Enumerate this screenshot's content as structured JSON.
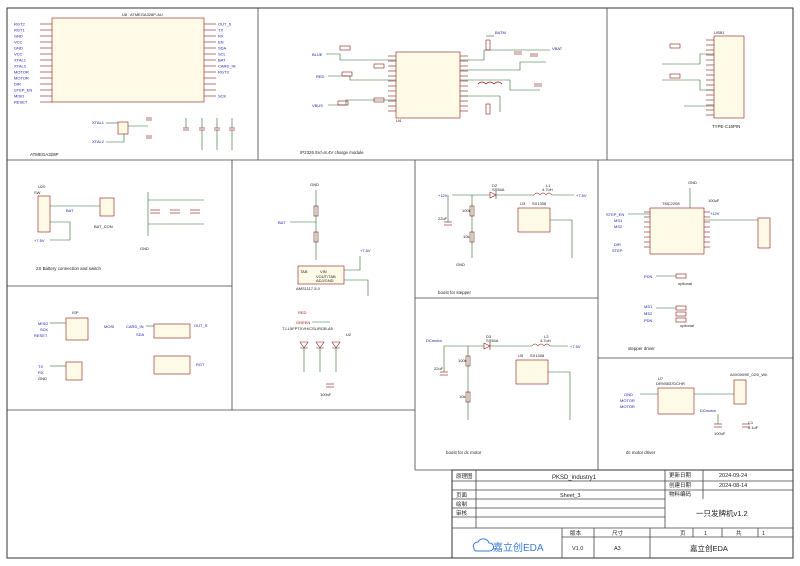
{
  "sections": {
    "mcu": {
      "caption": "ATMEGA328P",
      "part": "ATMEGA328P-AU",
      "ref": "U8",
      "left_nets": [
        "RGT2",
        "RGT1",
        "GND",
        "VCC",
        "GND",
        "VCC",
        "XTAL1",
        "XTAL2",
        "MOTOR",
        "MOTOR",
        "DIR",
        "STEP_EN",
        "MISO",
        "RESET"
      ],
      "right_nets": [
        "OUT_S",
        "TX",
        "RX",
        "EN",
        "SDA",
        "SCL",
        "BAT",
        "CARD_IN",
        "RGT3",
        "",
        "",
        "",
        "SCK"
      ],
      "xtal": [
        "XTAL1",
        "XTAL2"
      ]
    },
    "charge": {
      "caption": "IP2326 5V/=8.4V charge module",
      "ref": "U4",
      "nets": [
        "BLUE",
        "RED",
        "VBUS",
        "BATM",
        "VBAT"
      ]
    },
    "usb": {
      "caption": "TYPE-C16PIN",
      "ref": "USB1"
    },
    "battery": {
      "caption": "2S Battery connection and switch",
      "labels": [
        "U20",
        "SW",
        "BAT",
        "BAT_CON",
        "+7.5V",
        "GND"
      ]
    },
    "ldo": {
      "labels": [
        "GND",
        "BAT",
        "RED",
        "GREEN",
        "AMS1117-5.0",
        "TJ-L5FPTXVH/CSL/RGB-A5",
        "U2",
        "+7.5V",
        "VIN",
        "VOUT/TAB",
        "ADJ/GND",
        "TAB",
        "100nF"
      ]
    },
    "boost_stepper": {
      "caption": "boost for stepper",
      "labels": [
        "D2",
        "SS54A",
        "L1",
        "4.7uH",
        "+12V",
        "+7.5V",
        "U3",
        "SX1308",
        "GND",
        "100k",
        "10k",
        "22uF"
      ]
    },
    "stepper": {
      "caption": "stepper driver",
      "part": "TMC2208",
      "labels": [
        "STEP_EN",
        "MS1",
        "MS2",
        "DIR",
        "STEP",
        "PDN",
        "MS1",
        "MS2",
        "PDN",
        "optional",
        "GND",
        "+12V",
        "100uF"
      ]
    },
    "isp": {
      "labels": [
        "ISP",
        "MISO",
        "SCK",
        "RESET",
        "MOSI",
        "VCC",
        "GND",
        "CARD_IN",
        "SDA",
        "RGT",
        "OUT_S",
        "TX",
        "RX",
        "GND"
      ]
    },
    "boost_dc": {
      "caption": "boost for dc motor",
      "labels": [
        "DCmotor",
        "D3",
        "SS54A",
        "L2",
        "4.7uH",
        "+7.5V",
        "U5",
        "SX1308",
        "100k",
        "10k",
        "22uF"
      ]
    },
    "dc": {
      "caption": "dc motor driver",
      "part": "DRV8837DCHR",
      "labels": [
        "U7",
        "MOTOR",
        "MOTOR",
        "GND",
        "DCmotor",
        "VCC",
        "MOTOR1",
        "C1",
        "0.1uF",
        "100uF",
        "A0X0009E_02/0_Wh"
      ]
    }
  },
  "title_block": {
    "row_labels": {
      "schematic": "原理图",
      "page": "页面",
      "drawn": "绘制",
      "review": "审核",
      "version": "版本",
      "size": "尺寸",
      "page_no": "页",
      "of": "共"
    },
    "project": "PKSD_industry1",
    "sheet": "Sheet_3",
    "update_label": "更新日期",
    "update_date": "2024-09-24",
    "create_label": "创建日期",
    "create_date": "2024-08-14",
    "part_code_label": "物料编码",
    "title": "一只发牌机v1.2",
    "version": "V1.0",
    "size": "A3",
    "page": "1",
    "total": "1",
    "company": "嘉立创EDA",
    "logo_text": "嘉立创EDA"
  },
  "colors": {
    "wire": "#2a6a2a",
    "component": "#8a1a1a",
    "net_label": "#1a1aa8",
    "logo": "#3a7bd5"
  }
}
